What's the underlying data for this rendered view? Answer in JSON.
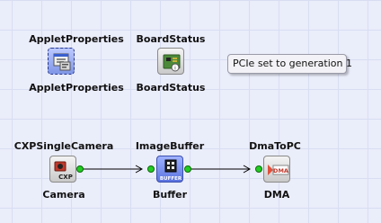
{
  "nodes": [
    {
      "key": "applet",
      "type_label": "AppletProperties",
      "instance_label": "AppletProperties",
      "icon": "applet-properties-icon"
    },
    {
      "key": "board",
      "type_label": "BoardStatus",
      "instance_label": "BoardStatus",
      "icon": "board-status-icon"
    },
    {
      "key": "camera",
      "type_label": "CXPSingleCamera",
      "instance_label": "Camera",
      "icon": "cxp-camera-icon",
      "icon_text": "CXP"
    },
    {
      "key": "buffer",
      "type_label": "ImageBuffer",
      "instance_label": "Buffer",
      "icon": "image-buffer-icon",
      "icon_text": "BUFFER"
    },
    {
      "key": "dma",
      "type_label": "DmaToPC",
      "instance_label": "DMA",
      "icon": "dma-icon",
      "icon_text": "DMA"
    }
  ],
  "note": {
    "text": "PCIe set to generation 1"
  },
  "links": [
    {
      "from": "Camera",
      "to": "Buffer"
    },
    {
      "from": "Buffer",
      "to": "DMA"
    }
  ],
  "colors": {
    "background": "#eaedfa",
    "grid": "#d8ddf2",
    "port": "#22cc22",
    "buffer": "#5a73e0",
    "dma": "#e0503a"
  }
}
